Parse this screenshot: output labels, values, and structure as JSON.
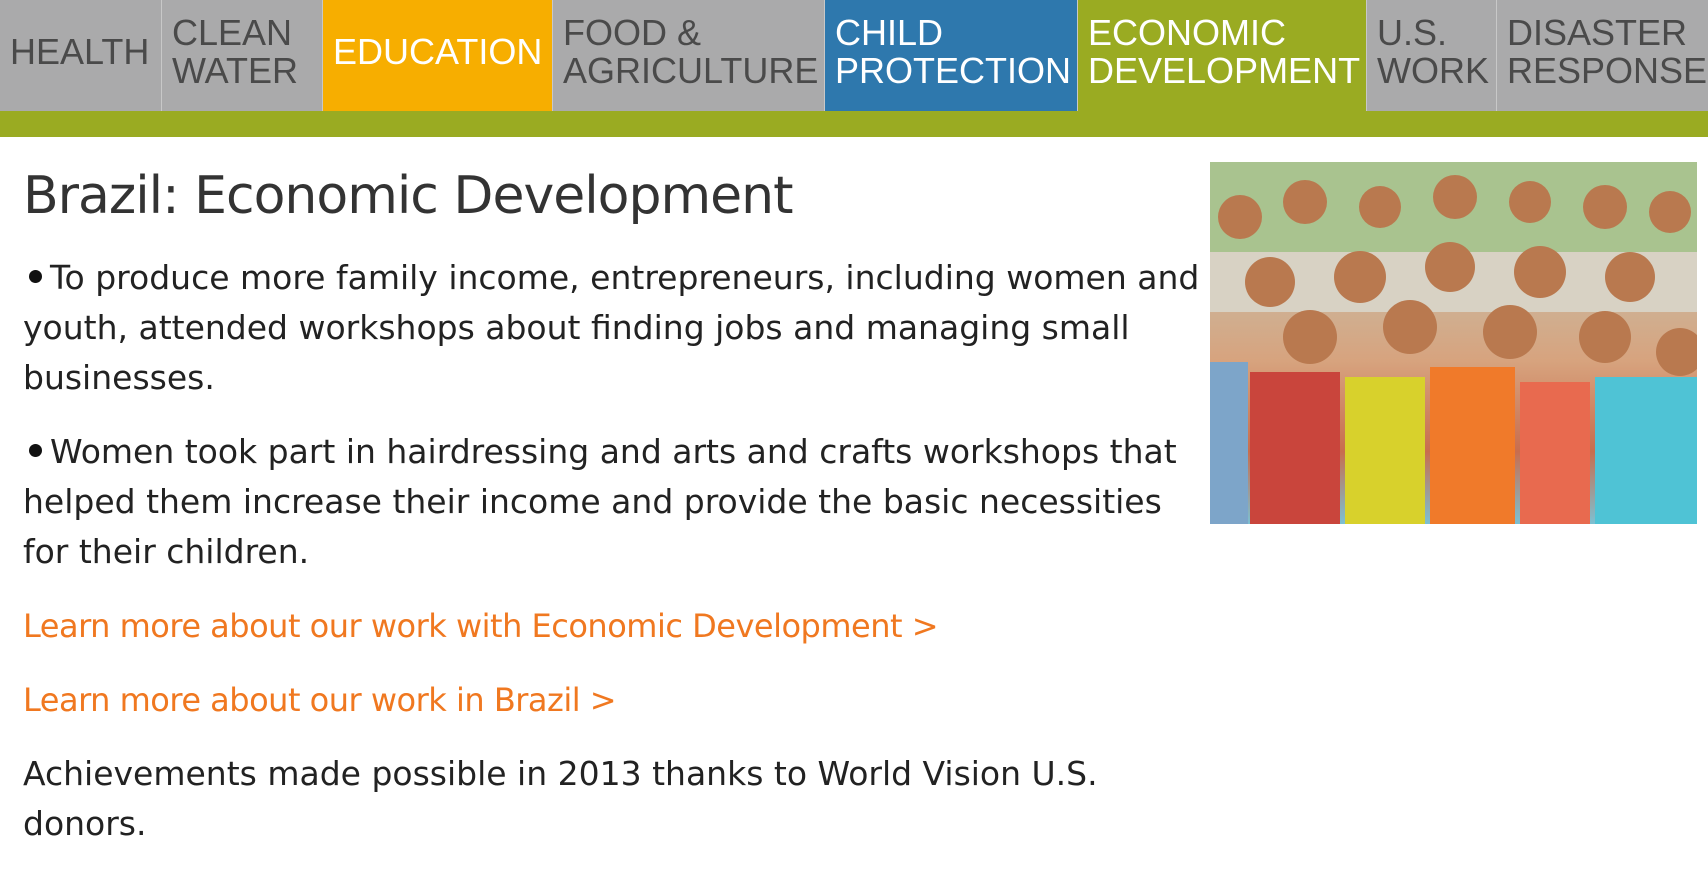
{
  "nav": {
    "tabs": [
      {
        "label": "HEALTH",
        "bg": "#aaaaab",
        "fg": "#4a4a4a"
      },
      {
        "label": "CLEAN\nWATER",
        "bg": "#aaaaab",
        "fg": "#4a4a4a"
      },
      {
        "label": "EDUCATION",
        "bg": "#f7ae00",
        "fg": "#ffffff"
      },
      {
        "label": "FOOD &\nAGRICULTURE",
        "bg": "#aaaaab",
        "fg": "#4a4a4a"
      },
      {
        "label": "CHILD\nPROTECTION",
        "bg": "#2e78ad",
        "fg": "#ffffff"
      },
      {
        "label": "ECONOMIC\nDEVELOPMENT",
        "bg": "#9aab22",
        "fg": "#ffffff"
      },
      {
        "label": "U.S.\nWORK",
        "bg": "#aaaaab",
        "fg": "#4a4a4a"
      },
      {
        "label": "DISASTER\nRESPONSE",
        "bg": "#aaaaab",
        "fg": "#4a4a4a"
      }
    ],
    "accent_bar_color": "#9aab22"
  },
  "content": {
    "title": "Brazil: Economic Development",
    "bullets": [
      "To produce more family income, entrepreneurs, including women and youth, attended workshops about finding jobs and managing small businesses.",
      "Women took part in hairdressing and arts and crafts workshops that helped them increase their income and provide the basic necessities for their children."
    ],
    "links": [
      "Learn more about our work with Economic Development >",
      "Learn more about our work in Brazil >"
    ],
    "link_color": "#f07820",
    "footnote": "Achievements made possible in 2013 thanks to World Vision U.S. donors."
  },
  "photo": {
    "subject": "group of smiling children waving"
  }
}
